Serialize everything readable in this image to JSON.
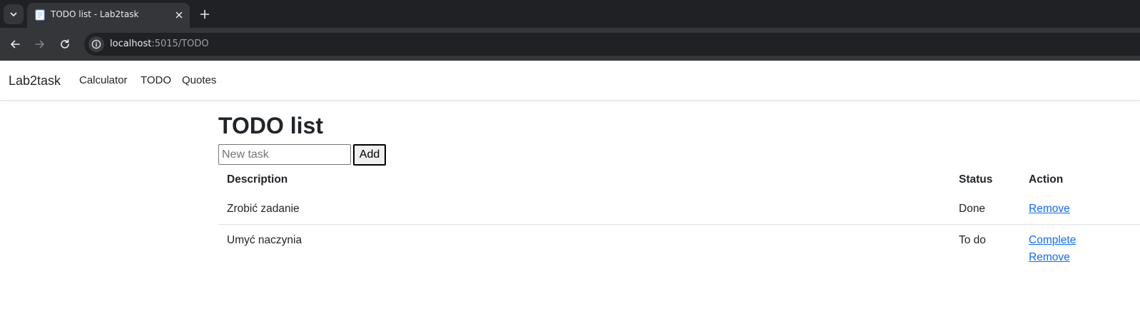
{
  "browser": {
    "tab_title": "TODO list - Lab2task",
    "url_host": "localhost",
    "url_path": ":5015/TODO",
    "icons": {
      "tab_search": "chevron-down-icon",
      "favicon": "document-icon",
      "close": "close-icon",
      "new_tab": "plus-icon",
      "back": "arrow-left-icon",
      "forward": "arrow-right-icon",
      "reload": "reload-icon",
      "site_info": "info-icon"
    },
    "colors": {
      "tabstrip": "#202124",
      "toolbar": "#35363a",
      "omnibox": "#202124"
    }
  },
  "navbar": {
    "brand": "Lab2task",
    "links": [
      "Calculator",
      "TODO",
      "Quotes"
    ]
  },
  "main": {
    "title": "TODO list",
    "input_placeholder": "New task",
    "add_label": "Add",
    "table": {
      "headers": [
        "Description",
        "Status",
        "Action"
      ],
      "rows": [
        {
          "description": "Zrobić zadanie",
          "status": "Done",
          "actions": [
            "Remove"
          ]
        },
        {
          "description": "Umyć naczynia",
          "status": "To do",
          "actions": [
            "Complete",
            "Remove"
          ]
        }
      ]
    }
  },
  "colors": {
    "link": "#0d6efd",
    "text": "#212529",
    "row_border": "#dee2e6"
  }
}
